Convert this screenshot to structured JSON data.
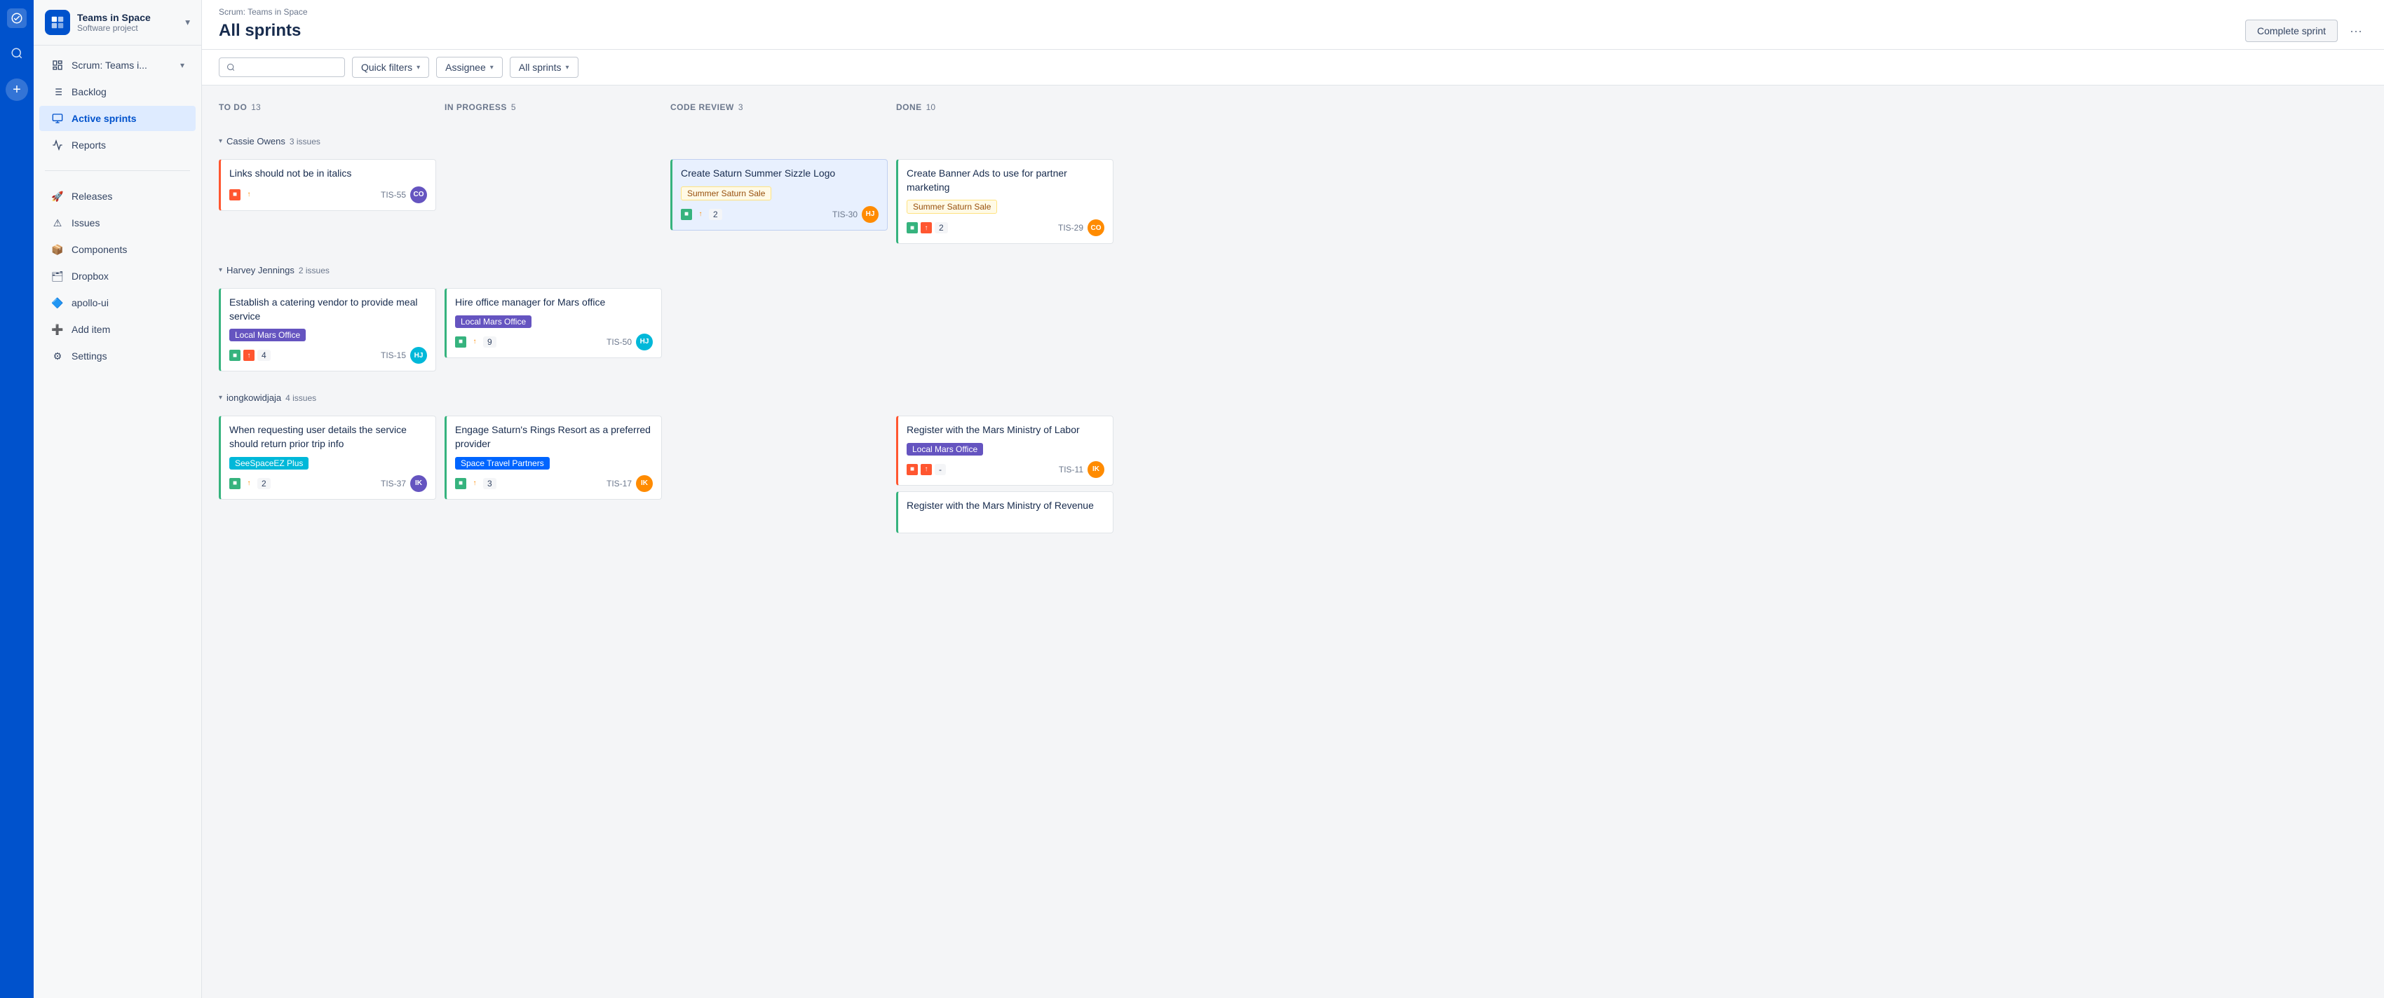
{
  "rail": {
    "logo_alt": "Linear logo"
  },
  "sidebar": {
    "project_name": "Teams in Space",
    "project_type": "Software project",
    "nav": [
      {
        "id": "scrum",
        "label": "Scrum: Teams i...",
        "icon": "board-icon",
        "has_chevron": true
      },
      {
        "id": "backlog",
        "label": "Backlog",
        "icon": "list-icon"
      },
      {
        "id": "active-sprints",
        "label": "Active sprints",
        "icon": "sprint-icon",
        "active": true
      },
      {
        "id": "reports",
        "label": "Reports",
        "icon": "chart-icon"
      }
    ],
    "secondary_nav": [
      {
        "id": "releases",
        "label": "Releases",
        "icon": "release-icon"
      },
      {
        "id": "issues",
        "label": "Issues",
        "icon": "issues-icon"
      },
      {
        "id": "components",
        "label": "Components",
        "icon": "components-icon"
      },
      {
        "id": "dropbox",
        "label": "Dropbox",
        "icon": "dropbox-icon"
      },
      {
        "id": "apollo-ui",
        "label": "apollo-ui",
        "icon": "apollo-icon"
      },
      {
        "id": "add-item",
        "label": "Add item",
        "icon": "add-item-icon"
      },
      {
        "id": "settings",
        "label": "Settings",
        "icon": "settings-icon"
      }
    ]
  },
  "header": {
    "breadcrumb": "Scrum: Teams in Space",
    "title": "All sprints",
    "complete_sprint_label": "Complete sprint",
    "more_label": "..."
  },
  "toolbar": {
    "search_placeholder": "",
    "quick_filters_label": "Quick filters",
    "assignee_label": "Assignee",
    "all_sprints_label": "All sprints"
  },
  "columns": [
    {
      "id": "todo",
      "title": "TO DO",
      "count": 13
    },
    {
      "id": "in-progress",
      "title": "IN PROGRESS",
      "count": 5
    },
    {
      "id": "code-review",
      "title": "CODE REVIEW",
      "count": 3
    },
    {
      "id": "done",
      "title": "DONE",
      "count": 10
    }
  ],
  "groups": [
    {
      "id": "cassie-owens",
      "name": "Cassie Owens",
      "issues_count": "3 issues",
      "cards": {
        "todo": [
          {
            "title": "Links should not be in italics",
            "tag": null,
            "border": "left-red",
            "icons": [
              "icon-red",
              "icon-orange"
            ],
            "badge": null,
            "id": "TIS-55",
            "avatar": "av-purple"
          }
        ],
        "in_progress": [],
        "code_review": [
          {
            "title": "Create Saturn Summer Sizzle Logo",
            "tag": "Summer Saturn Sale",
            "tag_class": "tag-yellow",
            "border": "left-green",
            "highlighted": true,
            "icons": [
              "icon-green",
              "icon-orange"
            ],
            "badge": "2",
            "id": "TIS-30",
            "avatar": "av-orange"
          }
        ],
        "done": [
          {
            "title": "Create Banner Ads to use for partner marketing",
            "tag": "Summer Saturn Sale",
            "tag_class": "tag-yellow",
            "border": "left-green",
            "icons": [
              "icon-green",
              "icon-red"
            ],
            "badge": "2",
            "id": "TIS-29",
            "avatar": "av-orange"
          }
        ]
      }
    },
    {
      "id": "harvey-jennings",
      "name": "Harvey Jennings",
      "issues_count": "2 issues",
      "cards": {
        "todo": [
          {
            "title": "Establish a catering vendor to provide meal service",
            "tag": "Local Mars Office",
            "tag_class": "tag-purple",
            "border": "left-green",
            "icons": [
              "icon-green",
              "icon-red"
            ],
            "badge": "4",
            "id": "TIS-15",
            "avatar": "av-teal"
          }
        ],
        "in_progress": [
          {
            "title": "Hire office manager for Mars office",
            "tag": "Local Mars Office",
            "tag_class": "tag-purple",
            "border": "left-green",
            "icons": [
              "icon-green",
              "icon-orange"
            ],
            "badge": "9",
            "id": "TIS-50",
            "avatar": "av-teal"
          }
        ],
        "code_review": [],
        "done": []
      }
    },
    {
      "id": "iongkowidjaja",
      "name": "iongkowidjaja",
      "issues_count": "4 issues",
      "cards": {
        "todo": [
          {
            "title": "When requesting user details the service should return prior trip info",
            "tag": "SeeSpaceEZ Plus",
            "tag_class": "tag-cyan",
            "border": "left-green",
            "icons": [
              "icon-green",
              "icon-orange"
            ],
            "badge": "2",
            "id": "TIS-37",
            "avatar": "av-purple"
          }
        ],
        "in_progress": [
          {
            "title": "Engage Saturn's Rings Resort as a preferred provider",
            "tag": "Space Travel Partners",
            "tag_class": "tag-blue",
            "border": "left-green",
            "icons": [
              "icon-green",
              "icon-orange"
            ],
            "badge": "3",
            "id": "TIS-17",
            "avatar": "av-orange"
          }
        ],
        "code_review": [],
        "done": [
          {
            "title": "Register with the Mars Ministry of Labor",
            "tag": "Local Mars Office",
            "tag_class": "tag-purple",
            "border": "left-red",
            "icons": [
              "icon-red",
              "icon-red"
            ],
            "badge": "-",
            "id": "TIS-11",
            "avatar": "av-orange"
          },
          {
            "title": "Register with the Mars Ministry of Revenue",
            "tag": null,
            "border": "left-green",
            "icons": [],
            "badge": null,
            "id": "",
            "avatar": null
          }
        ]
      }
    }
  ]
}
